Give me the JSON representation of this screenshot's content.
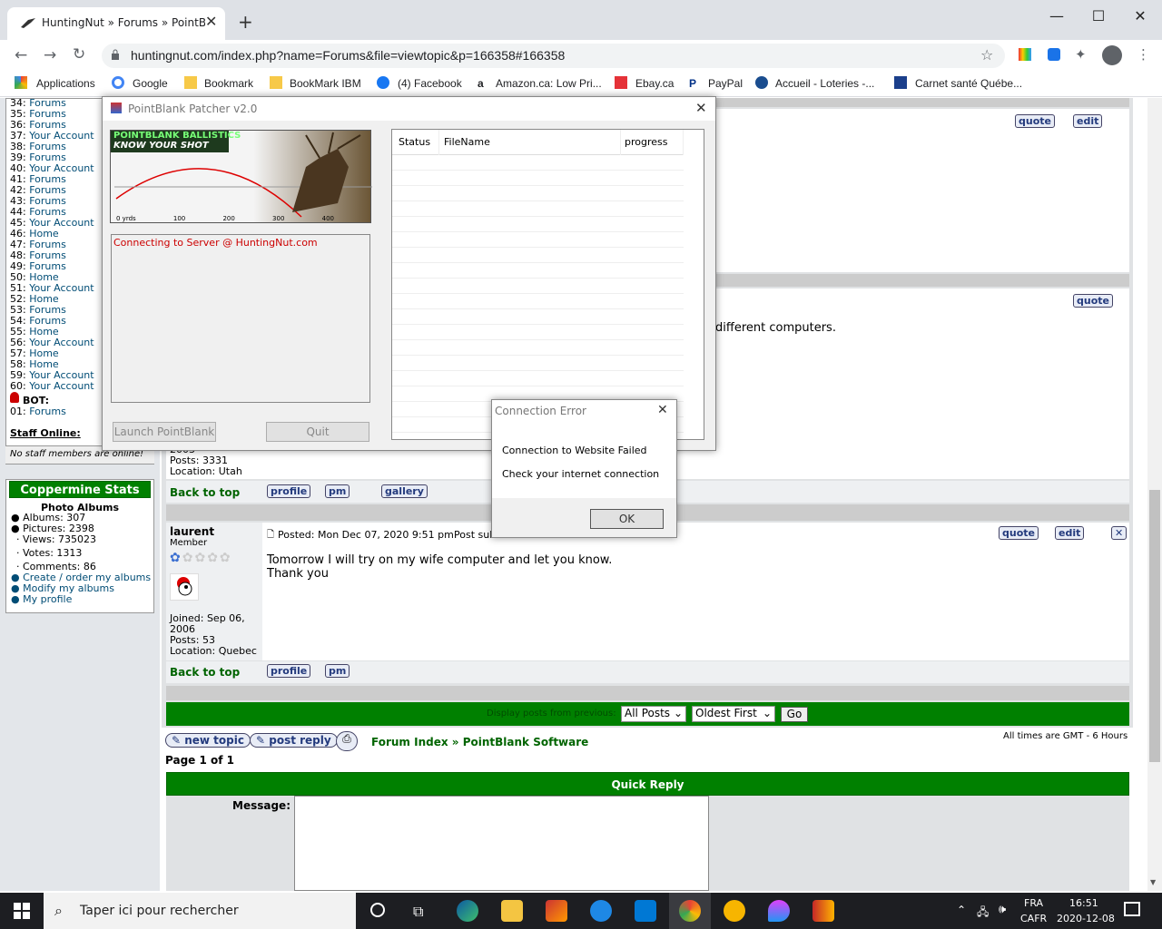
{
  "browser": {
    "tab_title": "HuntingNut » Forums » PointBlank",
    "url": "huntingnut.com/index.php?name=Forums&file=viewtopic&p=166358#166358"
  },
  "bookmarks": [
    "Applications",
    "Google",
    "Bookmark",
    "BookMark IBM",
    "(4) Facebook",
    "Amazon.ca: Low Pri...",
    "Ebay.ca",
    "PayPal",
    "Accueil - Loteries -...",
    "Carnet santé Québe..."
  ],
  "online": [
    {
      "n": "34:",
      "l": "Forums"
    },
    {
      "n": "35:",
      "l": "Forums"
    },
    {
      "n": "36:",
      "l": "Forums"
    },
    {
      "n": "37:",
      "l": "Your Account"
    },
    {
      "n": "38:",
      "l": "Forums"
    },
    {
      "n": "39:",
      "l": "Forums"
    },
    {
      "n": "40:",
      "l": "Your Account"
    },
    {
      "n": "41:",
      "l": "Forums"
    },
    {
      "n": "42:",
      "l": "Forums"
    },
    {
      "n": "43:",
      "l": "Forums"
    },
    {
      "n": "44:",
      "l": "Forums"
    },
    {
      "n": "45:",
      "l": "Your Account"
    },
    {
      "n": "46:",
      "l": "Home"
    },
    {
      "n": "47:",
      "l": "Forums"
    },
    {
      "n": "48:",
      "l": "Forums"
    },
    {
      "n": "49:",
      "l": "Forums"
    },
    {
      "n": "50:",
      "l": "Home"
    },
    {
      "n": "51:",
      "l": "Your Account"
    },
    {
      "n": "52:",
      "l": "Home"
    },
    {
      "n": "53:",
      "l": "Forums"
    },
    {
      "n": "54:",
      "l": "Forums"
    },
    {
      "n": "55:",
      "l": "Home"
    },
    {
      "n": "56:",
      "l": "Your Account"
    },
    {
      "n": "57:",
      "l": "Home"
    },
    {
      "n": "58:",
      "l": "Home"
    },
    {
      "n": "59:",
      "l": "Your Account"
    },
    {
      "n": "60:",
      "l": "Your Account"
    }
  ],
  "bot": {
    "label": "BOT:",
    "n": "01:",
    "l": "Forums"
  },
  "staff": {
    "title": "Staff Online:",
    "none": "No staff members are online!"
  },
  "coppermine": {
    "title": "Coppermine Stats",
    "photo": "Photo Albums",
    "albums": "Albums: 307",
    "pictures": "Pictures: 2398",
    "views": "Views: 735023",
    "votes": "Votes: 1313",
    "comments": "Comments: 86",
    "create": "Create / order my albums",
    "modify": "Modify my albums",
    "profile": "My profile"
  },
  "post_top": {
    "quote": "quote",
    "edit": "edit"
  },
  "post_mid": {
    "quote": "quote",
    "text": "different computers."
  },
  "post_prev": {
    "joined": "2003",
    "posts": "Posts: 3331",
    "location": "Location: Utah",
    "back": "Back to top",
    "profile": "profile",
    "pm": "pm",
    "gallery": "gallery"
  },
  "post_laurent": {
    "author": "laurent",
    "rank": "Member",
    "posted": "Posted: Mon Dec 07, 2020 9:51 pm",
    "subject": "Post sub",
    "line1": "Tomorrow I will try on my wife computer and let you know.",
    "line2": "Thank you",
    "joined": "Joined: Sep 06,",
    "joined2": "2006",
    "posts": "Posts: 53",
    "location": "Location: Quebec",
    "back": "Back to top",
    "profile": "profile",
    "pm": "pm",
    "quote": "quote",
    "edit": "edit"
  },
  "display": {
    "label": "Display posts from previous:",
    "opt1": "All Posts",
    "opt2": "Oldest First",
    "go": "Go"
  },
  "nav": {
    "new_topic": "new topic",
    "post_reply": "post reply",
    "forum_index": "Forum Index",
    "sep": "»",
    "software": "PointBlank Software",
    "page": "Page 1 of 1",
    "times": "All times are GMT - 6 Hours"
  },
  "quick": {
    "title": "Quick Reply",
    "message": "Message:"
  },
  "patcher": {
    "title": "PointBlank Patcher v2.0",
    "banner1": "POINTBLANK BALLISTICS",
    "banner2": "KNOW YOUR SHOT",
    "log": "Connecting to Server @ HuntingNut.com",
    "launch": "Launch PointBlank",
    "quit": "Quit",
    "col_status": "Status",
    "col_file": "FileName",
    "col_progress": "progress",
    "axis": [
      "0 yrds",
      "100",
      "200",
      "300",
      "400"
    ]
  },
  "error": {
    "title": "Connection Error",
    "line1": "Connection to Website Failed",
    "line2": "Check your internet connection",
    "ok": "OK"
  },
  "taskbar": {
    "search": "Taper ici pour rechercher",
    "lang1": "FRA",
    "lang2": "CAFR",
    "time": "16:51",
    "date": "2020-12-08"
  }
}
